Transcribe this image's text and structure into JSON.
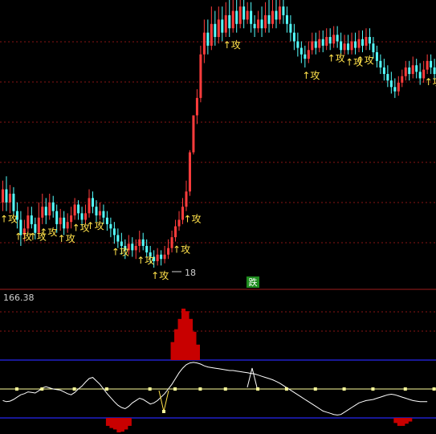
{
  "colors": {
    "background": "#000000",
    "up": "#ff3c3c",
    "down": "#54ffff",
    "grid": "#8a1414",
    "divider": "#a01e1e",
    "signal": "#ffe14a",
    "osc_line": "#ffffff",
    "band": "#2020c8",
    "mid_line": "#ffff9a",
    "histogram": "#c80000",
    "badge_bg": "#1e8c1e"
  },
  "main_panel": {
    "low_marker": "18",
    "badge": "跌",
    "attack_label": "攻",
    "arrow_glyph": "↑",
    "signals": [
      {
        "idx": 0
      },
      {
        "idx": 4
      },
      {
        "idx": 8
      },
      {
        "idx": 11
      },
      {
        "idx": 16
      },
      {
        "idx": 20
      },
      {
        "idx": 24
      },
      {
        "idx": 31
      },
      {
        "idx": 38
      },
      {
        "idx": 42
      },
      {
        "idx": 48
      },
      {
        "idx": 51
      },
      {
        "idx": 62
      },
      {
        "idx": 84
      },
      {
        "idx": 91
      },
      {
        "idx": 96
      },
      {
        "idx": 99
      },
      {
        "idx": 118
      }
    ]
  },
  "sub_panel": {
    "value_label": "166.38"
  },
  "chart_data": {
    "type": "candlestick-with-oscillator",
    "candles": [
      [
        0.62,
        0.68,
        0.58,
        0.72
      ],
      [
        0.68,
        0.62,
        0.58,
        0.74
      ],
      [
        0.62,
        0.66,
        0.57,
        0.7
      ],
      [
        0.66,
        0.58,
        0.56,
        0.69
      ],
      [
        0.58,
        0.54,
        0.5,
        0.62
      ],
      [
        0.54,
        0.47,
        0.42,
        0.58
      ],
      [
        0.47,
        0.5,
        0.44,
        0.54
      ],
      [
        0.5,
        0.56,
        0.48,
        0.6
      ],
      [
        0.56,
        0.52,
        0.5,
        0.6
      ],
      [
        0.52,
        0.48,
        0.45,
        0.55
      ],
      [
        0.48,
        0.55,
        0.46,
        0.62
      ],
      [
        0.55,
        0.6,
        0.52,
        0.66
      ],
      [
        0.6,
        0.56,
        0.52,
        0.64
      ],
      [
        0.56,
        0.62,
        0.54,
        0.66
      ],
      [
        0.62,
        0.58,
        0.55,
        0.65
      ],
      [
        0.58,
        0.52,
        0.48,
        0.61
      ],
      [
        0.52,
        0.55,
        0.49,
        0.59
      ],
      [
        0.55,
        0.5,
        0.47,
        0.58
      ],
      [
        0.5,
        0.53,
        0.48,
        0.57
      ],
      [
        0.53,
        0.56,
        0.5,
        0.6
      ],
      [
        0.56,
        0.61,
        0.54,
        0.64
      ],
      [
        0.61,
        0.57,
        0.54,
        0.63
      ],
      [
        0.57,
        0.54,
        0.51,
        0.6
      ],
      [
        0.54,
        0.57,
        0.52,
        0.61
      ],
      [
        0.57,
        0.64,
        0.55,
        0.68
      ],
      [
        0.64,
        0.6,
        0.57,
        0.67
      ],
      [
        0.6,
        0.56,
        0.53,
        0.63
      ],
      [
        0.56,
        0.58,
        0.54,
        0.62
      ],
      [
        0.58,
        0.55,
        0.52,
        0.61
      ],
      [
        0.55,
        0.52,
        0.49,
        0.58
      ],
      [
        0.52,
        0.5,
        0.46,
        0.55
      ],
      [
        0.5,
        0.47,
        0.43,
        0.53
      ],
      [
        0.47,
        0.44,
        0.41,
        0.5
      ],
      [
        0.44,
        0.42,
        0.38,
        0.48
      ],
      [
        0.42,
        0.4,
        0.36,
        0.45
      ],
      [
        0.4,
        0.43,
        0.38,
        0.47
      ],
      [
        0.43,
        0.4,
        0.37,
        0.46
      ],
      [
        0.4,
        0.42,
        0.36,
        0.45
      ],
      [
        0.42,
        0.45,
        0.39,
        0.49
      ],
      [
        0.45,
        0.42,
        0.4,
        0.48
      ],
      [
        0.42,
        0.39,
        0.37,
        0.45
      ],
      [
        0.39,
        0.37,
        0.34,
        0.42
      ],
      [
        0.37,
        0.35,
        0.32,
        0.4
      ],
      [
        0.35,
        0.38,
        0.33,
        0.41
      ],
      [
        0.38,
        0.36,
        0.33,
        0.4
      ],
      [
        0.36,
        0.38,
        0.34,
        0.42
      ],
      [
        0.38,
        0.41,
        0.36,
        0.45
      ],
      [
        0.41,
        0.46,
        0.39,
        0.49
      ],
      [
        0.46,
        0.51,
        0.44,
        0.54
      ],
      [
        0.51,
        0.54,
        0.49,
        0.58
      ],
      [
        0.54,
        0.6,
        0.52,
        0.64
      ],
      [
        0.6,
        0.67,
        0.58,
        0.72
      ],
      [
        0.67,
        0.85,
        0.65,
        0.86
      ],
      [
        0.85,
        1.02,
        0.84,
        1.02
      ],
      [
        1.02,
        1.1,
        0.98,
        1.14
      ],
      [
        1.1,
        1.3,
        1.08,
        1.34
      ],
      [
        1.3,
        1.4,
        1.26,
        1.46
      ],
      [
        1.4,
        1.34,
        1.3,
        1.46
      ],
      [
        1.34,
        1.44,
        1.32,
        1.52
      ],
      [
        1.44,
        1.38,
        1.34,
        1.5
      ],
      [
        1.38,
        1.46,
        1.35,
        1.52
      ],
      [
        1.46,
        1.4,
        1.36,
        1.52
      ],
      [
        1.4,
        1.48,
        1.38,
        1.54
      ],
      [
        1.48,
        1.42,
        1.38,
        1.56
      ],
      [
        1.42,
        1.5,
        1.4,
        1.56
      ],
      [
        1.5,
        1.44,
        1.4,
        1.56
      ],
      [
        1.44,
        1.52,
        1.42,
        1.58
      ],
      [
        1.52,
        1.46,
        1.42,
        1.56
      ],
      [
        1.46,
        1.5,
        1.44,
        1.54
      ],
      [
        1.5,
        1.44,
        1.4,
        1.54
      ],
      [
        1.44,
        1.42,
        1.38,
        1.48
      ],
      [
        1.42,
        1.46,
        1.4,
        1.5
      ],
      [
        1.46,
        1.42,
        1.38,
        1.52
      ],
      [
        1.42,
        1.48,
        1.4,
        1.54
      ],
      [
        1.48,
        1.44,
        1.4,
        1.56
      ],
      [
        1.44,
        1.5,
        1.42,
        1.56
      ],
      [
        1.5,
        1.46,
        1.42,
        1.56
      ],
      [
        1.46,
        1.52,
        1.44,
        1.58
      ],
      [
        1.52,
        1.48,
        1.44,
        1.58
      ],
      [
        1.48,
        1.44,
        1.4,
        1.52
      ],
      [
        1.44,
        1.4,
        1.36,
        1.48
      ],
      [
        1.4,
        1.36,
        1.32,
        1.44
      ],
      [
        1.36,
        1.33,
        1.29,
        1.4
      ],
      [
        1.33,
        1.3,
        1.26,
        1.36
      ],
      [
        1.3,
        1.28,
        1.24,
        1.34
      ],
      [
        1.28,
        1.32,
        1.26,
        1.36
      ],
      [
        1.32,
        1.36,
        1.3,
        1.4
      ],
      [
        1.36,
        1.33,
        1.3,
        1.4
      ],
      [
        1.33,
        1.37,
        1.31,
        1.41
      ],
      [
        1.37,
        1.34,
        1.31,
        1.41
      ],
      [
        1.34,
        1.38,
        1.32,
        1.42
      ],
      [
        1.38,
        1.35,
        1.32,
        1.42
      ],
      [
        1.35,
        1.39,
        1.33,
        1.43
      ],
      [
        1.39,
        1.36,
        1.33,
        1.43
      ],
      [
        1.36,
        1.32,
        1.3,
        1.4
      ],
      [
        1.32,
        1.35,
        1.3,
        1.39
      ],
      [
        1.35,
        1.32,
        1.3,
        1.39
      ],
      [
        1.32,
        1.36,
        1.3,
        1.4
      ],
      [
        1.36,
        1.33,
        1.3,
        1.4
      ],
      [
        1.33,
        1.37,
        1.31,
        1.41
      ],
      [
        1.37,
        1.34,
        1.31,
        1.41
      ],
      [
        1.34,
        1.38,
        1.32,
        1.42
      ],
      [
        1.38,
        1.35,
        1.32,
        1.42
      ],
      [
        1.35,
        1.31,
        1.28,
        1.38
      ],
      [
        1.31,
        1.27,
        1.24,
        1.34
      ],
      [
        1.27,
        1.24,
        1.21,
        1.3
      ],
      [
        1.24,
        1.21,
        1.18,
        1.28
      ],
      [
        1.21,
        1.18,
        1.15,
        1.25
      ],
      [
        1.18,
        1.15,
        1.12,
        1.22
      ],
      [
        1.15,
        1.13,
        1.1,
        1.19
      ],
      [
        1.13,
        1.17,
        1.11,
        1.2
      ],
      [
        1.17,
        1.2,
        1.15,
        1.23
      ],
      [
        1.2,
        1.24,
        1.18,
        1.27
      ],
      [
        1.24,
        1.21,
        1.18,
        1.27
      ],
      [
        1.21,
        1.25,
        1.19,
        1.29
      ],
      [
        1.25,
        1.22,
        1.19,
        1.28
      ],
      [
        1.22,
        1.19,
        1.16,
        1.26
      ],
      [
        1.19,
        1.23,
        1.17,
        1.27
      ],
      [
        1.23,
        1.27,
        1.21,
        1.3
      ],
      [
        1.27,
        1.24,
        1.21,
        1.3
      ],
      [
        1.24,
        1.21,
        1.18,
        1.28
      ],
      [
        1.21,
        1.26,
        1.19,
        1.3
      ],
      [
        1.26,
        1.22,
        1.19,
        1.3
      ]
    ],
    "oscillator": [
      0.3,
      0.28,
      0.29,
      0.32,
      0.36,
      0.4,
      0.42,
      0.45,
      0.44,
      0.43,
      0.47,
      0.52,
      0.54,
      0.52,
      0.5,
      0.49,
      0.48,
      0.45,
      0.42,
      0.4,
      0.44,
      0.5,
      0.55,
      0.62,
      0.68,
      0.7,
      0.64,
      0.58,
      0.5,
      0.42,
      0.35,
      0.28,
      0.22,
      0.18,
      0.16,
      0.2,
      0.26,
      0.3,
      0.34,
      0.32,
      0.28,
      0.24,
      0.26,
      0.3,
      0.36,
      0.42,
      0.5,
      0.58,
      0.68,
      0.78,
      0.86,
      0.92,
      0.95,
      0.96,
      0.95,
      0.93,
      0.9,
      0.88,
      0.87,
      0.86,
      0.85,
      0.84,
      0.83,
      0.82,
      0.82,
      0.81,
      0.8,
      0.79,
      0.78,
      0.77,
      0.76,
      0.74,
      0.72,
      0.7,
      0.68,
      0.66,
      0.63,
      0.6,
      0.56,
      0.52,
      0.48,
      0.44,
      0.4,
      0.36,
      0.32,
      0.28,
      0.24,
      0.2,
      0.16,
      0.12,
      0.1,
      0.08,
      0.06,
      0.05,
      0.06,
      0.1,
      0.14,
      0.18,
      0.22,
      0.26,
      0.28,
      0.3,
      0.31,
      0.32,
      0.34,
      0.36,
      0.38,
      0.4,
      0.41,
      0.4,
      0.38,
      0.36,
      0.34,
      0.32,
      0.3,
      0.29,
      0.28,
      0.28,
      0.28
    ],
    "histogram": [
      {
        "idx": 29,
        "value": -0.55
      },
      {
        "idx": 30,
        "value": -0.7
      },
      {
        "idx": 31,
        "value": -0.8
      },
      {
        "idx": 32,
        "value": -1.0
      },
      {
        "idx": 33,
        "value": -0.95
      },
      {
        "idx": 34,
        "value": -0.8
      },
      {
        "idx": 35,
        "value": -0.55
      },
      {
        "idx": 47,
        "value": 0.35
      },
      {
        "idx": 48,
        "value": 0.6
      },
      {
        "idx": 49,
        "value": 0.8
      },
      {
        "idx": 50,
        "value": 1.0
      },
      {
        "idx": 51,
        "value": 0.95
      },
      {
        "idx": 52,
        "value": 0.8
      },
      {
        "idx": 53,
        "value": 0.55
      },
      {
        "idx": 54,
        "value": 0.3
      },
      {
        "idx": 109,
        "value": -0.35
      },
      {
        "idx": 110,
        "value": -0.55
      },
      {
        "idx": 111,
        "value": -0.55
      },
      {
        "idx": 112,
        "value": -0.4
      },
      {
        "idx": 113,
        "value": -0.25
      }
    ],
    "mid_markers": [
      4,
      11,
      20,
      29,
      41,
      48,
      55,
      62,
      71,
      79,
      87,
      95,
      103,
      112,
      120
    ]
  }
}
